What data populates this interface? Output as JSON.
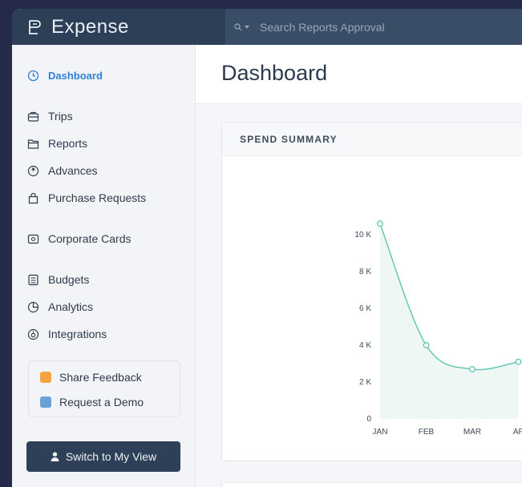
{
  "brand": {
    "name": "Expense"
  },
  "search": {
    "placeholder": "Search Reports Approval"
  },
  "sidebar": {
    "items": [
      {
        "label": "Dashboard",
        "icon": "clock-icon",
        "active": true
      },
      {
        "label": "Trips",
        "icon": "briefcase-icon"
      },
      {
        "label": "Reports",
        "icon": "folder-icon"
      },
      {
        "label": "Advances",
        "icon": "advance-clock-icon"
      },
      {
        "label": "Purchase Requests",
        "icon": "bag-icon"
      },
      {
        "label": "Corporate Cards",
        "icon": "card-icon"
      },
      {
        "label": "Budgets",
        "icon": "budget-icon"
      },
      {
        "label": "Analytics",
        "icon": "pie-chart-icon"
      },
      {
        "label": "Integrations",
        "icon": "integrations-icon"
      }
    ],
    "share_feedback": "Share Feedback",
    "request_demo": "Request a Demo",
    "switch_view": "Switch to My View"
  },
  "main": {
    "title": "Dashboard",
    "card_title": "SPEND SUMMARY"
  },
  "colors": {
    "accent": "#2f80d8",
    "topbar": "#2c3f57",
    "line": "#5cc7b0",
    "feedback_icon": "#f4a340",
    "demo_icon": "#6aa2d8"
  },
  "chart_data": {
    "type": "area",
    "categories": [
      "JAN",
      "FEB",
      "MAR",
      "AP"
    ],
    "values": [
      10600,
      4000,
      2700,
      3100
    ],
    "yticks": [
      "0",
      "2 K",
      "4 K",
      "6 K",
      "8 K",
      "10 K"
    ],
    "ylim": [
      0,
      12000
    ],
    "title": "SPEND SUMMARY",
    "xlabel": "",
    "ylabel": ""
  }
}
